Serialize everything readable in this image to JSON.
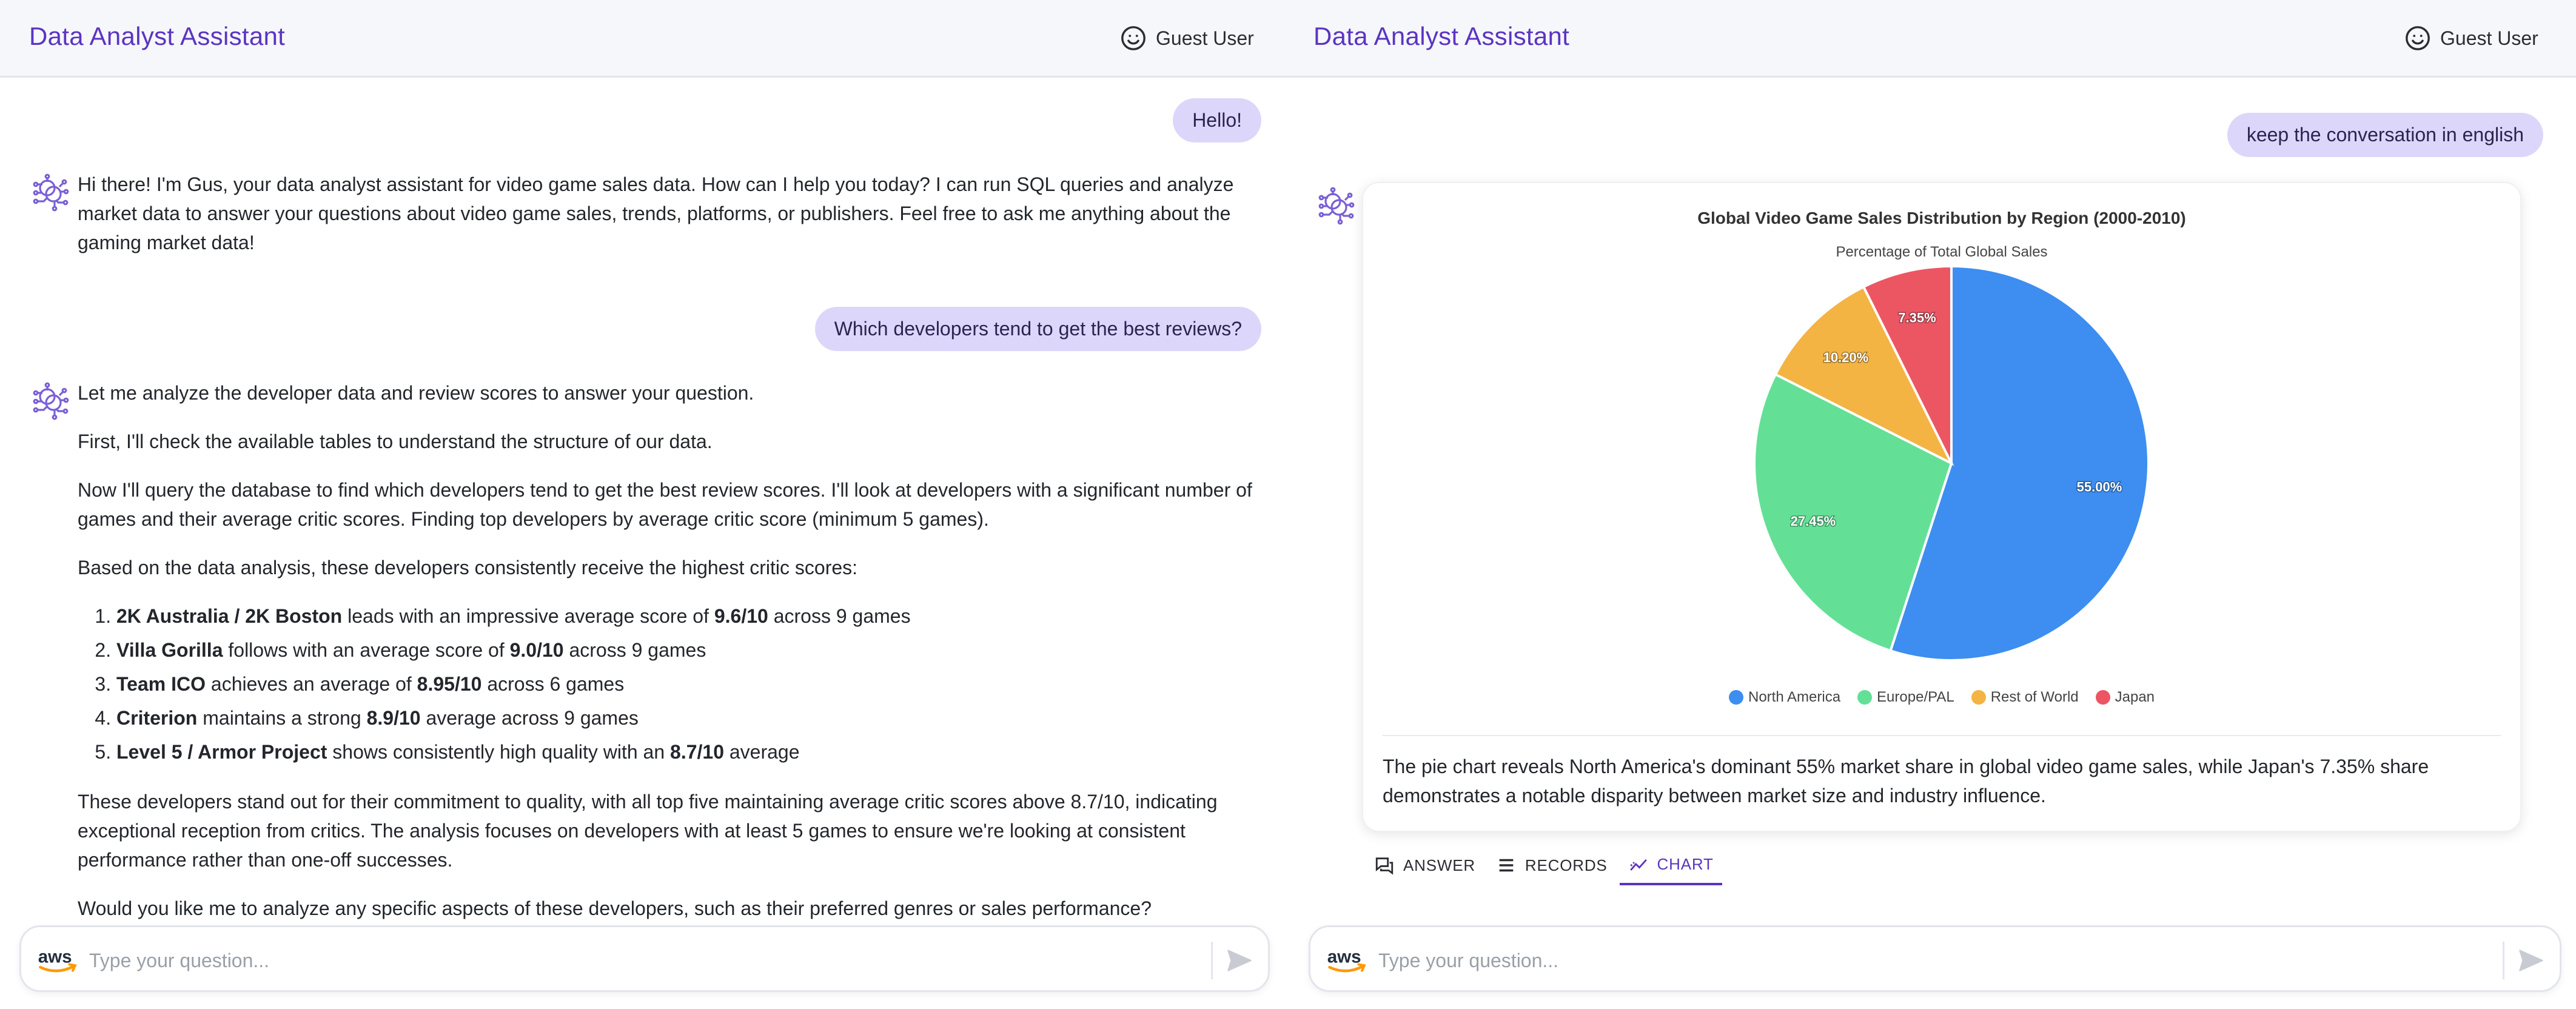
{
  "app": {
    "title": "Data Analyst Assistant",
    "user_label": "Guest User",
    "accent_color": "#5b34c2"
  },
  "left_panel": {
    "messages": {
      "user_1": "Hello!",
      "bot_1": "Hi there! I'm Gus, your data analyst assistant for video game sales data. How can I help you today? I can run SQL queries and analyze market data to answer your questions about video game sales, trends, platforms, or publishers. Feel free to ask me anything about the gaming market data!",
      "user_2": "Which developers tend to get the best reviews?",
      "bot_2": {
        "p1": "Let me analyze the developer data and review scores to answer your question.",
        "p2": "First, I'll check the available tables to understand the structure of our data.",
        "p3": "Now I'll query the database to find which developers tend to get the best review scores. I'll look at developers with a significant number of games and their average critic scores. Finding top developers by average critic score (minimum 5 games).",
        "p4": "Based on the data analysis, these developers consistently receive the highest critic scores:",
        "list": [
          {
            "name": "2K Australia / 2K Boston",
            "pre": " leads with an impressive average score of ",
            "score": "9.6/10",
            "post": " across 9 games"
          },
          {
            "name": "Villa Gorilla",
            "pre": " follows with an average score of ",
            "score": "9.0/10",
            "post": " across 9 games"
          },
          {
            "name": "Team ICO",
            "pre": " achieves an average of ",
            "score": "8.95/10",
            "post": " across 6 games"
          },
          {
            "name": "Criterion",
            "pre": " maintains a strong ",
            "score": "8.9/10",
            "post": " average across 9 games"
          },
          {
            "name": "Level 5 / Armor Project",
            "pre": " shows consistently high quality with an ",
            "score": "8.7/10",
            "post": " average"
          }
        ],
        "p5": "These developers stand out for their commitment to quality, with all top five maintaining average critic scores above 8.7/10, indicating exceptional reception from critics. The analysis focuses on developers with at least 5 games to ensure we're looking at consistent performance rather than one-off successes.",
        "p6": "Would you like me to analyze any specific aspects of these developers, such as their preferred genres or sales performance?"
      }
    },
    "input": {
      "placeholder": "Type your question..."
    }
  },
  "right_panel": {
    "messages": {
      "user_1": "keep the conversation in english"
    },
    "chart_caption": "The pie chart reveals North America's dominant 55% market share in global video game sales, while Japan's 7.35% share demonstrates a notable disparity between market size and industry influence.",
    "tabs": [
      {
        "label": "ANSWER",
        "active": false
      },
      {
        "label": "RECORDS",
        "active": false
      },
      {
        "label": "CHART",
        "active": true
      }
    ],
    "input": {
      "placeholder": "Type your question..."
    }
  },
  "chart_data": {
    "type": "pie",
    "title": "Global Video Game Sales Distribution by Region (2000-2010)",
    "subtitle": "Percentage of Total Global Sales",
    "categories": [
      "North America",
      "Europe/PAL",
      "Rest of World",
      "Japan"
    ],
    "values": [
      55.0,
      27.45,
      10.2,
      7.35
    ],
    "labels": [
      "55.00%",
      "27.45%",
      "10.20%",
      "7.35%"
    ],
    "colors": [
      "#3d8ef0",
      "#63e096",
      "#f3b444",
      "#ec5663"
    ],
    "legend_position": "bottom"
  }
}
